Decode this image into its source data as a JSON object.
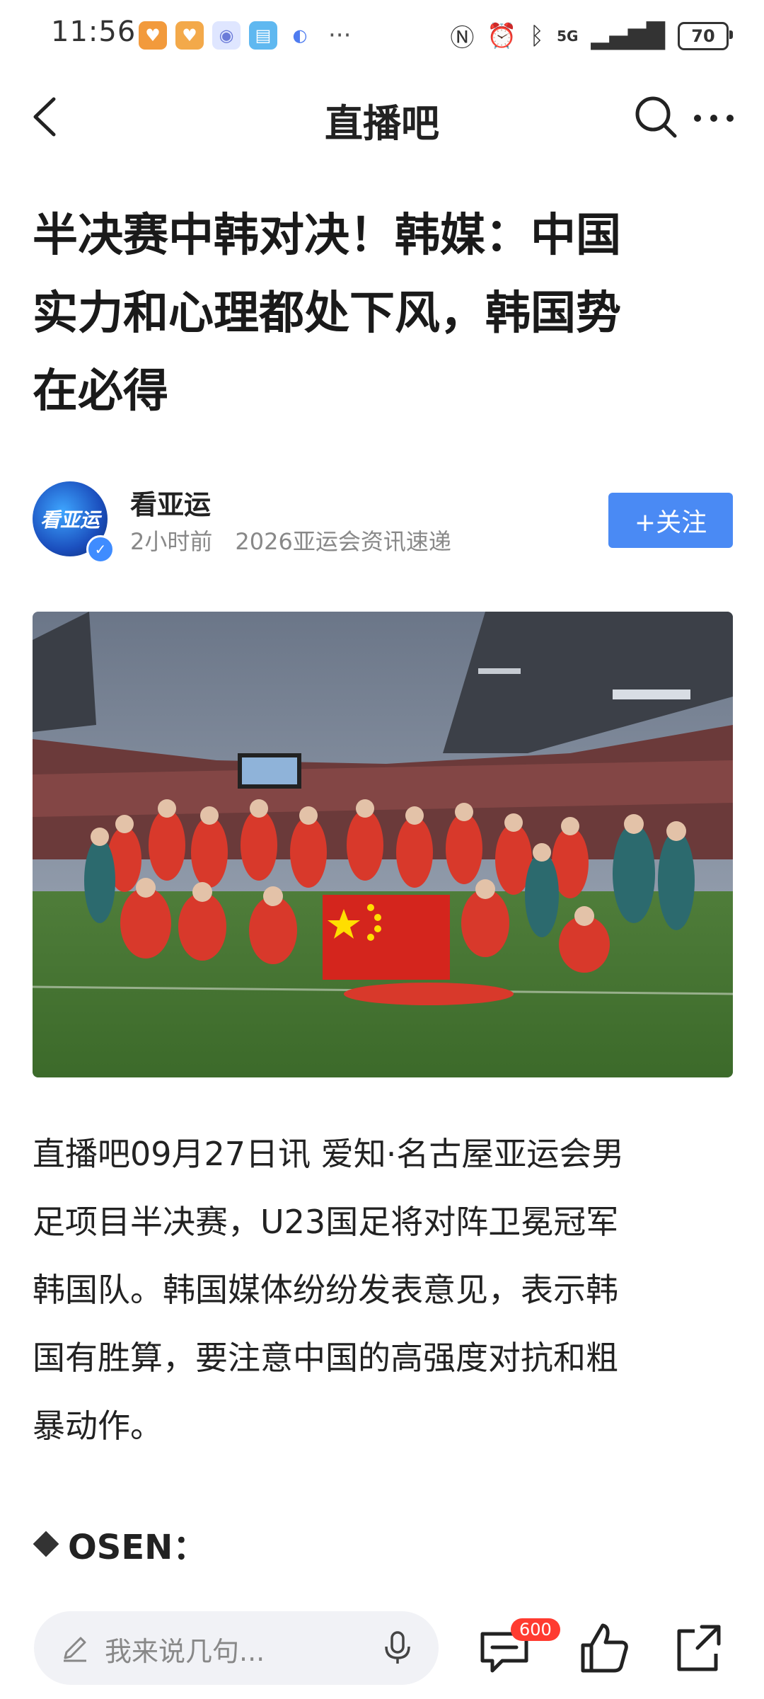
{
  "status_bar": {
    "time": "11:56",
    "network": "5G",
    "battery": "70",
    "more_glyph": "···"
  },
  "nav": {
    "title": "直播吧"
  },
  "article": {
    "headline_lines": [
      "半决赛中韩对决！韩媒：中国",
      "实力和心理都处下风，韩国势",
      "在必得"
    ],
    "author": {
      "avatar_text": "看亚运",
      "name": "看亚运",
      "time_ago": "2小时前",
      "tagline": "2026亚运会资讯速递",
      "follow_label": "+关注"
    },
    "body_lines": [
      "直播吧09月27日讯 爱知·名古屋亚运会男",
      "足项目半决赛，U23国足将对阵卫冕冠军",
      "韩国队。韩国媒体纷纷发表意见，表示韩",
      "国有胜算，要注意中国的高强度对抗和粗",
      "暴动作。"
    ],
    "subheading": "OSEN："
  },
  "bottom_bar": {
    "comment_placeholder": "我来说几句...",
    "comment_count": "600"
  },
  "colors": {
    "accent": "#4a8af4",
    "badge": "#ff3b30"
  }
}
